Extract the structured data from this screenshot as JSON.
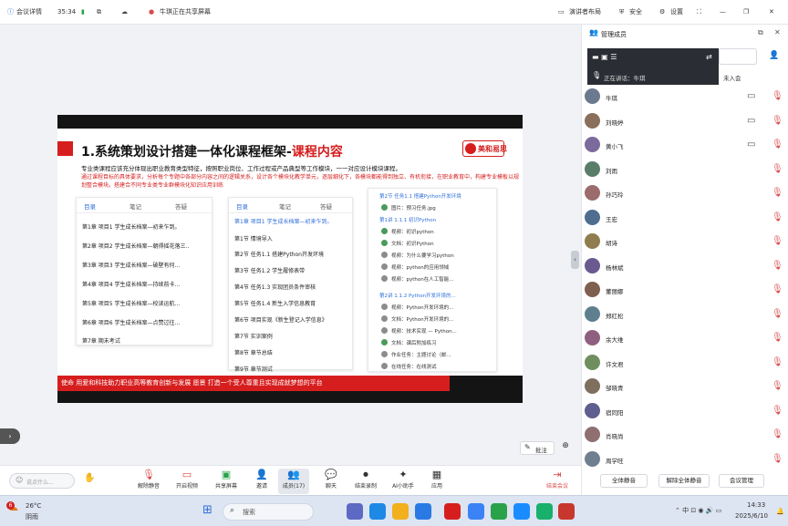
{
  "topbar": {
    "meeting_detail": "会议详情",
    "time": "35:34",
    "title": "牛琪正在共享屏幕",
    "speaker_view": "演讲者布局",
    "security": "安全",
    "settings": "设置"
  },
  "slide": {
    "title_main": "1.系统策划设计搭建一体化课程框架-",
    "title_red": "课程内容",
    "logo_text": "美和易思",
    "para1": "专业类课程应该充分体现出职业教育类型特征，按照职业岗位、工作过程或产品典型等工作模块，一一对应设计模块课程。",
    "para2": "通过课程目标的具体要求，分析每个专题中各部分内容之间的逻辑关系，设计各个模块化教学单元，逐层细化下，各模块都能得到独立、有机衔接，在职业教育中，构建专业模板以规划整合模块。搭建合不同专业类专业群模块化知识应用训练",
    "mission": "使命  用爱和科技助力职业高等教育创新与发展    愿景  打造一个受人尊重且实现成就梦想的平台"
  },
  "panel1": {
    "tabs": [
      "目录",
      "笔记",
      "答疑"
    ],
    "rows": [
      "第1章  项目1 学生成长档案—初来乍到。",
      "第2章  项目2 学生成长档案—朝得摇花落三..",
      "第3章  项目3 学生成长档案—破壁有何...",
      "第4章  项目4 学生成长档案—持续前卡...",
      "第5章  项目5 学生成长档案—校读运航...",
      "第6章  项目6 学生成长档案—点赞过往...",
      "第7章  期末考试"
    ]
  },
  "panel2": {
    "tabs": [
      "目录",
      "笔记",
      "答疑"
    ],
    "rows": [
      "第1章  项目1 学生成长档案—初来乍到。",
      "第1节  情境导入",
      "第2节  任务1.1 搭建Python开发环境",
      "第3节  任务1.2 学生履修表带",
      "第4节  任务1.3 实现团员条件审核",
      "第5节  任务1.4 新生入学信息教育",
      "第6节  项目实现《新生登记入学信息》",
      "第7节  实训案例",
      "第8节  章节总结",
      "第9节  章节测试"
    ]
  },
  "panel3": {
    "rows": [
      "第2节  任务1.1 搭建Python开发环境",
      "图片：预习任务.jpg",
      "第1讲  1.1.1 初识Python",
      "视频：初识python",
      "文档：初识Python",
      "视频：为什么要学习python",
      "视频：python的应用领域",
      "视频：python在人工智能...",
      "第2讲  1.1.2 Python开发环境的...",
      "视频：Python开发环境的...",
      "文档：Python开发环境的...",
      "视频：技术实现 — Python...",
      "文档：课后附加练习",
      "作业任务：主题讨论（邮...",
      "在线任务：在线测试"
    ]
  },
  "sidebar": {
    "title": "管理成员",
    "speaking": "正在讲话：牛琪",
    "not_joined": "未入会",
    "members": [
      "牛琪",
      "刘晓婷",
      "黄小飞",
      "刘雨",
      "孙巧玲",
      "王宏",
      "胡诗",
      "杨林斌",
      "董丽娜",
      "郑红松",
      "余大维",
      "许文君",
      "邹晓青",
      "宿同阳",
      "肖晓尚",
      "周学旺"
    ],
    "mute_all": "全体静音",
    "unmute_all": "解除全体静音",
    "manage": "会议管理"
  },
  "stage": {
    "annotate": "批注"
  },
  "toolbar": {
    "chat_placeholder": "说点什么...",
    "items": [
      "解除静音",
      "开启视频",
      "共享屏幕",
      "邀请",
      "成员(17)",
      "聊天",
      "结束录制",
      "AI小助手",
      "应用"
    ],
    "leave": "结束会议"
  },
  "taskbar": {
    "weather_temp": "26°C",
    "weather_desc": "阴雨",
    "search": "搜索",
    "time": "14:33",
    "date": "2025/6/10",
    "badge": "6"
  },
  "colors": {
    "accent": "#2f6fd8",
    "red": "#d61e1e",
    "mic_muted": "#d94a4a"
  }
}
